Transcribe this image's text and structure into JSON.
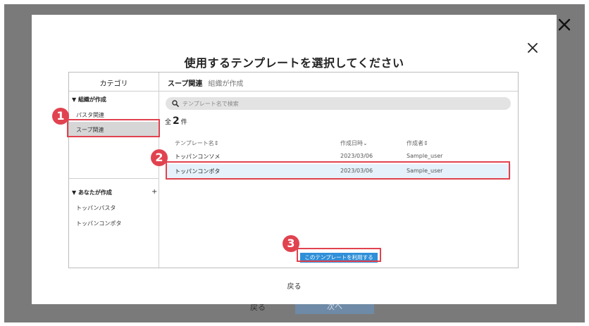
{
  "background": {
    "back_label": "戻る",
    "next_label": "次へ"
  },
  "modal": {
    "title": "使用するテンプレートを選択してください",
    "back_label": "戻る"
  },
  "sidebar": {
    "header": "カテゴリ",
    "org_section": {
      "title": "▼ 組織が作成",
      "items": [
        "パスタ関連",
        "スープ関連"
      ]
    },
    "you_section": {
      "title": "▼ あなたが作成",
      "plus": "+",
      "items": [
        "トッパンパスタ",
        "トッパンコンポタ"
      ]
    }
  },
  "main": {
    "category_title": "スープ関連",
    "category_sub": "組織が作成",
    "search_placeholder": "テンプレート名で検索",
    "count_prefix": "全",
    "count_value": "2",
    "count_suffix": "件",
    "columns": [
      "テンプレート名⇕",
      "作成日時⌄",
      "作成者⇕"
    ],
    "rows": [
      {
        "name": "トッパンコンソメ",
        "date": "2023/03/06",
        "author": "Sample_user"
      },
      {
        "name": "トッパンコンポタ",
        "date": "2023/03/06",
        "author": "Sample_user"
      }
    ],
    "use_button": "このテンプレートを利用する"
  },
  "annotations": {
    "badges": [
      "1",
      "2",
      "3"
    ],
    "color": "#e1424f"
  },
  "colors": {
    "primary": "#2f8fd8",
    "selected_row": "#e6f2fb",
    "selected_category": "#d6d6d6"
  }
}
